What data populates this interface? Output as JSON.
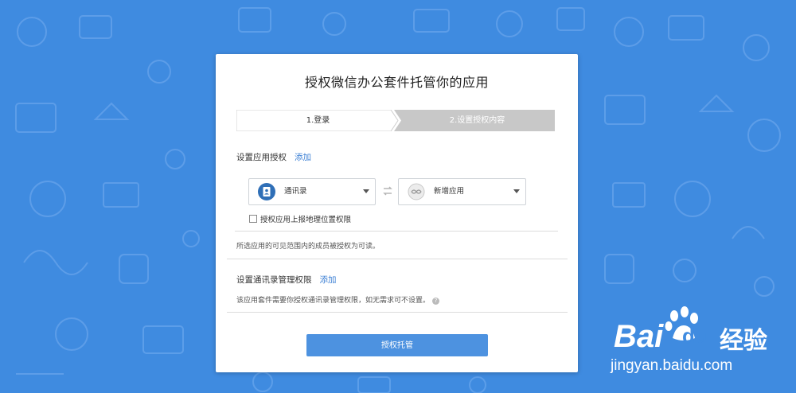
{
  "page": {
    "title": "授权微信办公套件托管你的应用"
  },
  "steps": [
    {
      "label": "1.登录",
      "state": "done"
    },
    {
      "label": "2.设置授权内容",
      "state": "current"
    }
  ],
  "app_auth": {
    "section_title": "设置应用授权",
    "add_label": "添加",
    "source_select": {
      "selected": "通讯录",
      "icon": "contacts-icon"
    },
    "target_select": {
      "selected": "新增应用",
      "icon": "new-app-icon"
    },
    "checkbox_label": "授权应用上报地理位置权限",
    "checkbox_checked": false,
    "note": "所选应用的可见范围内的成员被授权为可读。"
  },
  "contacts_auth": {
    "section_title": "设置通讯录管理权限",
    "add_label": "添加",
    "note": "该应用套件需要你授权通讯录管理权限，如无需求可不设置。",
    "help_icon": "?"
  },
  "submit": {
    "label": "授权托管"
  },
  "watermark": {
    "brand_latin": "Bai",
    "brand_paw": "du",
    "brand_cn": "经验",
    "url": "jingyan.baidu.com"
  },
  "colors": {
    "background": "#3f8be0",
    "primary": "#4d92e0",
    "link": "#3b7fd4",
    "step_done": "#ffffff",
    "step_current": "#c8c8c8"
  }
}
